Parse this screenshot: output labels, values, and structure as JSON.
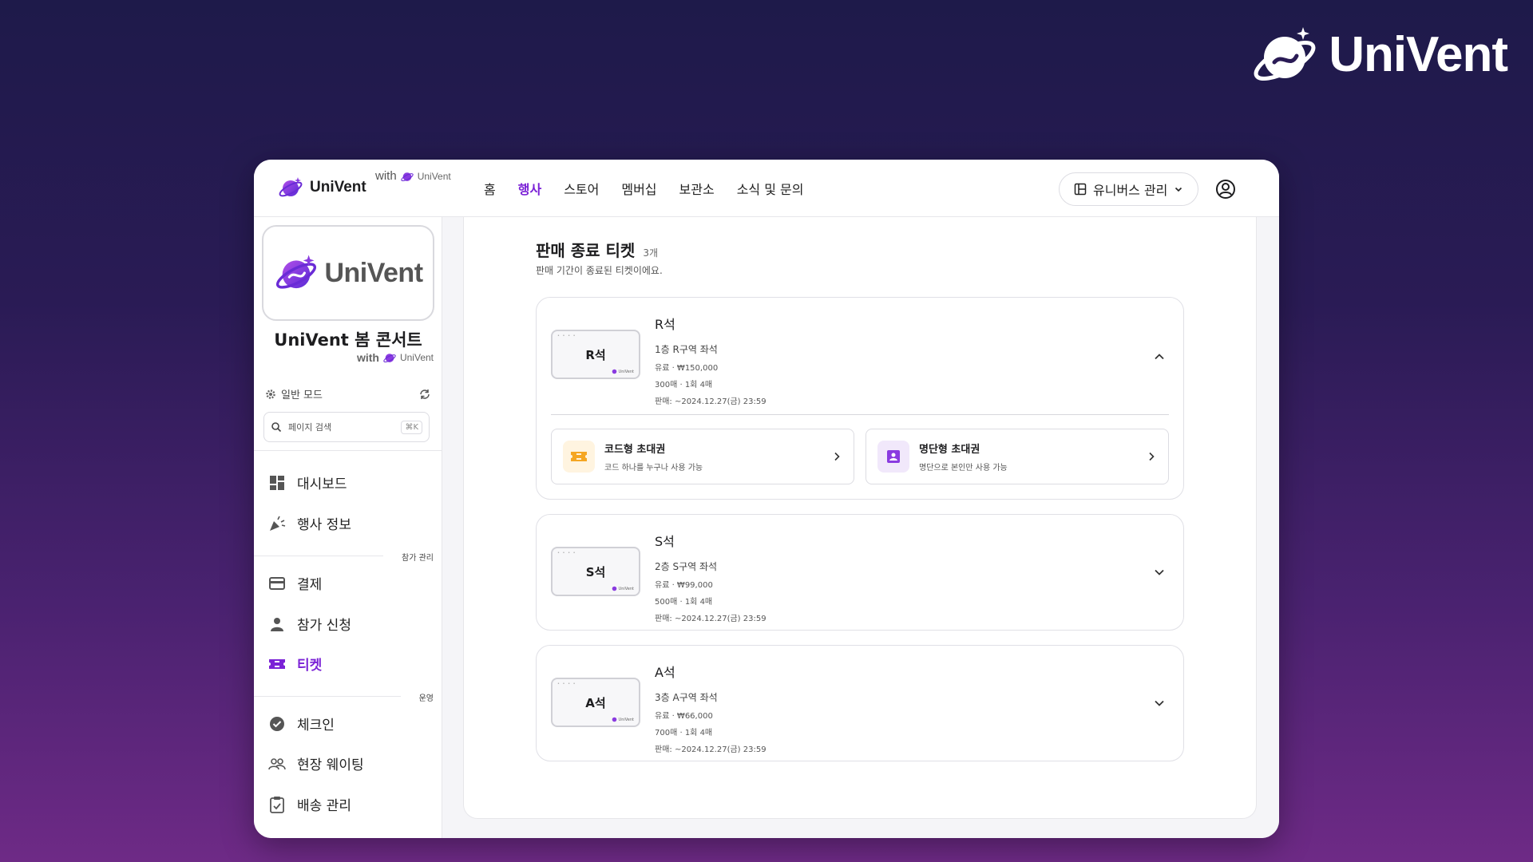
{
  "brand": {
    "name": "UniVent"
  },
  "topbar": {
    "logo_text": "UniVent",
    "with_text": "with",
    "with_brand": "UniVent",
    "nav": [
      {
        "label": "홈",
        "active": false
      },
      {
        "label": "행사",
        "active": true
      },
      {
        "label": "스토어",
        "active": false
      },
      {
        "label": "멤버십",
        "active": false
      },
      {
        "label": "보관소",
        "active": false
      },
      {
        "label": "소식 및 문의",
        "active": false
      }
    ],
    "universe_button": "유니버스 관리"
  },
  "sidebar": {
    "logo_text": "UniVent",
    "event_title": "UniVent 봄 콘서트",
    "with_text": "with",
    "with_brand": "UniVent",
    "mode_label": "일반 모드",
    "search_placeholder": "페이지 검색",
    "search_shortcut": "⌘K",
    "items": [
      {
        "label": "대시보드",
        "icon": "dashboard-icon"
      },
      {
        "label": "행사 정보",
        "icon": "party-popper-icon"
      },
      {
        "label": "결제",
        "icon": "credit-card-icon"
      },
      {
        "label": "참가 신청",
        "icon": "person-icon"
      },
      {
        "label": "티켓",
        "icon": "ticket-icon",
        "active": true
      },
      {
        "label": "체크인",
        "icon": "check-circle-icon"
      },
      {
        "label": "현장 웨이팅",
        "icon": "group-icon"
      },
      {
        "label": "배송 관리",
        "icon": "clipboard-check-icon"
      }
    ],
    "sections": [
      "참가 관리",
      "운영"
    ]
  },
  "main": {
    "title": "판매 종료 티켓",
    "count": "3개",
    "subtitle": "판매 기간이 종료된 티켓이에요.",
    "tickets": [
      {
        "thumb": "R석",
        "name": "R석",
        "desc": "1층 R구역 좌석",
        "price": "유료 · ₩150,000",
        "qty": "300매 · 1회 4매",
        "period": "판매: ~2024.12.27(금) 23:59",
        "expanded": true
      },
      {
        "thumb": "S석",
        "name": "S석",
        "desc": "2층 S구역 좌석",
        "price": "유료 · ₩99,000",
        "qty": "500매 · 1회 4매",
        "period": "판매: ~2024.12.27(금) 23:59",
        "expanded": false
      },
      {
        "thumb": "A석",
        "name": "A석",
        "desc": "3층 A구역 좌석",
        "price": "유료 · ₩66,000",
        "qty": "700매 · 1회 4매",
        "period": "판매: ~2024.12.27(금) 23:59",
        "expanded": false
      }
    ],
    "invites": [
      {
        "title": "코드형 초대권",
        "desc": "코드 하나를 누구나 사용 가능",
        "icon": "ticket-code-icon"
      },
      {
        "title": "명단형 초대권",
        "desc": "명단으로 본인만 사용 가능",
        "icon": "contact-list-icon"
      }
    ],
    "thumb_mini_brand": "UniVent"
  },
  "colors": {
    "accent": "#7b22d6",
    "invite_code_bg": "#fff4e0",
    "invite_code_fg": "#f5a623",
    "invite_list_bg": "#f1e8fb"
  }
}
